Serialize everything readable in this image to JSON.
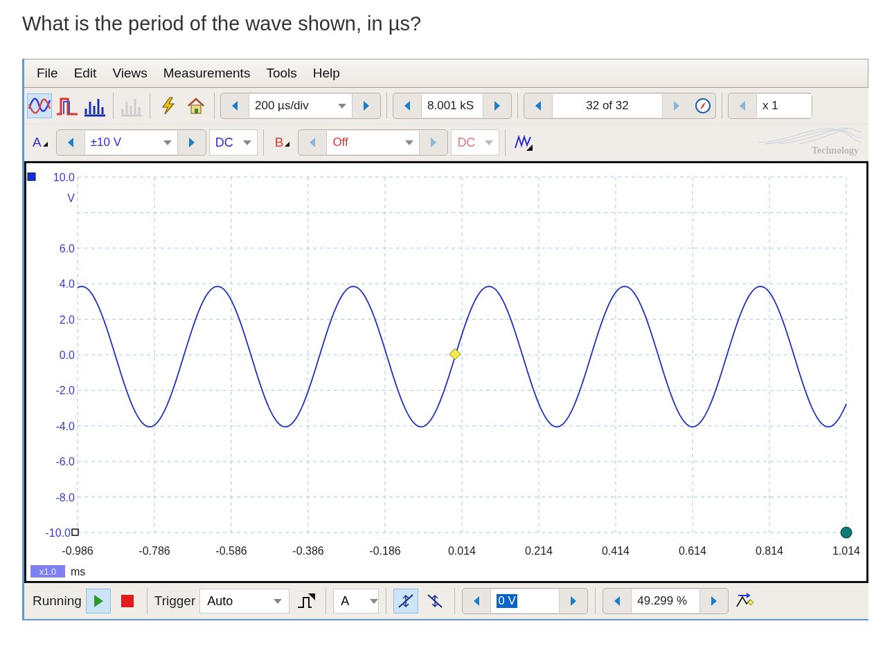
{
  "question": "What is the period of the wave shown, in µs?",
  "menu": [
    "File",
    "Edit",
    "Views",
    "Measurements",
    "Tools",
    "Help"
  ],
  "modes": [
    {
      "kind": "scope",
      "selected": true,
      "disabled": false
    },
    {
      "kind": "persistence",
      "selected": false,
      "disabled": false
    },
    {
      "kind": "spectrum",
      "selected": false,
      "disabled": false
    },
    {
      "kind": "spectrum",
      "selected": false,
      "disabled": true
    }
  ],
  "timebase": "200 µs/div",
  "samples": "8.001 kS",
  "buffer": "32 of 32",
  "zoom": "x 1",
  "channels": [
    {
      "name": "A",
      "range": "±10 V",
      "coupling": "DC",
      "enabled": true,
      "color": "#2b2bd6"
    },
    {
      "name": "B",
      "range": "Off",
      "coupling": "DC",
      "enabled": false,
      "color": "#e03a3a"
    }
  ],
  "logo_text": "Technology",
  "plot": {
    "y_labels": [
      "10.0",
      "V",
      "6.0",
      "4.0",
      "2.0",
      "0.0",
      "-2.0",
      "-4.0",
      "-6.0",
      "-8.0",
      "-10.0"
    ],
    "x_labels": [
      "-0.986",
      "-0.786",
      "-0.586",
      "-0.386",
      "-0.186",
      "0.014",
      "0.214",
      "0.414",
      "0.614",
      "0.814",
      "1.014"
    ],
    "zoom_badge": "x1.0",
    "x_unit": "ms"
  },
  "status": {
    "state": "Running",
    "running": true,
    "trigger_label": "Trigger",
    "trigger_mode": "Auto",
    "trigger_channel": "A",
    "edges": [
      {
        "selected": true
      },
      {
        "selected": false
      }
    ],
    "threshold": "0 V",
    "pretrigger": "49.299 %"
  }
}
